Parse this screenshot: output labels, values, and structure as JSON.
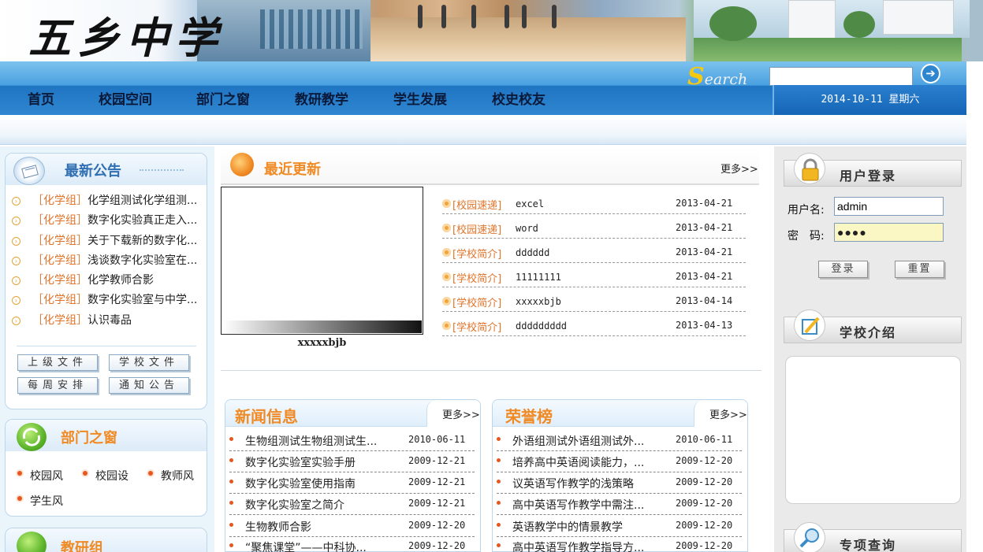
{
  "header": {
    "school_name": "五乡中学",
    "search_logo_first": "S",
    "search_logo_rest": "earch",
    "search_placeholder": "",
    "search_go_icon": "arrow-right-icon",
    "date": "2014-10-11 星期六"
  },
  "nav": {
    "items": [
      "首页",
      "校园空间",
      "部门之窗",
      "教研教学",
      "学生发展",
      "校史校友"
    ]
  },
  "notices": {
    "title": "最新公告",
    "items": [
      {
        "cat": "［化学组］",
        "text": "化学组测试化学组测..."
      },
      {
        "cat": "［化学组］",
        "text": "数字化实验真正走入..."
      },
      {
        "cat": "［化学组］",
        "text": "关于下载新的数字化..."
      },
      {
        "cat": "［化学组］",
        "text": "浅谈数字化实验室在..."
      },
      {
        "cat": "［化学组］",
        "text": "化学教师合影"
      },
      {
        "cat": "［化学组］",
        "text": "数字化实验室与中学..."
      },
      {
        "cat": "［化学组］",
        "text": "认识毒品"
      }
    ],
    "buttons": [
      "上级文件",
      "学校文件",
      "每周安排",
      "通知公告"
    ]
  },
  "departments": {
    "title": "部门之窗",
    "links": [
      "校园风",
      "校园设",
      "教师风",
      "学生风"
    ]
  },
  "teaching": {
    "title": "教研组"
  },
  "recent": {
    "title": "最近更新",
    "more": "更多>>",
    "preview_caption": "xxxxxbjb",
    "items": [
      {
        "tag": "[校园速递]",
        "name": "excel",
        "date": "2013-04-21"
      },
      {
        "tag": "[校园速递]",
        "name": "word",
        "date": "2013-04-21"
      },
      {
        "tag": "[学校简介]",
        "name": "dddddd",
        "date": "2013-04-21"
      },
      {
        "tag": "[学校简介]",
        "name": "11111111",
        "date": "2013-04-21"
      },
      {
        "tag": "[学校简介]",
        "name": "xxxxxbjb",
        "date": "2013-04-14"
      },
      {
        "tag": "[学校简介]",
        "name": "ddddddddd",
        "date": "2013-04-13"
      }
    ]
  },
  "news": {
    "title": "新闻信息",
    "more": "更多>>",
    "items": [
      {
        "title": "生物组测试生物组测试生...",
        "date": "2010-06-11"
      },
      {
        "title": "数字化实验室实验手册",
        "date": "2009-12-21"
      },
      {
        "title": "数字化实验室使用指南",
        "date": "2009-12-21"
      },
      {
        "title": "数字化实验室之简介",
        "date": "2009-12-21"
      },
      {
        "title": "生物教师合影",
        "date": "2009-12-20"
      },
      {
        "title": "“聚焦课堂”——中科协...",
        "date": "2009-12-20"
      }
    ]
  },
  "honor": {
    "title": "荣誉榜",
    "more": "更多>>",
    "items": [
      {
        "title": "外语组测试外语组测试外...",
        "date": "2010-06-11"
      },
      {
        "title": "培养高中英语阅读能力，...",
        "date": "2009-12-20"
      },
      {
        "title": "议英语写作教学的浅策略",
        "date": "2009-12-20"
      },
      {
        "title": "高中英语写作教学中需注...",
        "date": "2009-12-20"
      },
      {
        "title": "英语教学中的情景教学",
        "date": "2009-12-20"
      },
      {
        "title": "高中英语写作教学指导方...",
        "date": "2009-12-20"
      }
    ]
  },
  "login": {
    "title": "用户登录",
    "username_label": "用户名:",
    "password_label": "密　码:",
    "username_value": "admin",
    "password_value": "●●●●",
    "login_button": "登录",
    "reset_button": "重置"
  },
  "school_intro": {
    "title": "学校介绍"
  },
  "special_query": {
    "title": "专项查询"
  }
}
